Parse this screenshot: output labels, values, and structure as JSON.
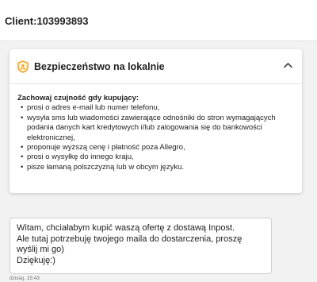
{
  "header": {
    "client_label": "Client:103993893"
  },
  "security_card": {
    "title": "Bezpieczeństwo na lokalnie",
    "icon": "shield-icon",
    "accent_color": "#f5a623",
    "subheading": "Zachowaj czujność gdy kupujący:",
    "tips": [
      "prosi o adres e-mail lub numer telefonu,",
      "wysyła sms lub wiadomości zawierające odnośniki do stron wymagających podania danych kart kredytowych i/lub zalogowania się do bankowości elektronicznej,",
      "proponuje wyższą cenę i płatność poza Allegro,",
      "prosi o wysyłkę do innego kraju,",
      "pisze łamaną polszczyzną lub w obcym języku."
    ]
  },
  "message": {
    "lines": [
      "Witam, chciałabym kupić waszą ofertę z dostawą Inpost.",
      "Ale tutaj potrzebuję twojego maila do dostarczenia, proszę wyślij mi go)",
      "Dziękuję:)"
    ],
    "timestamp": "dzisiaj, 15:43"
  }
}
